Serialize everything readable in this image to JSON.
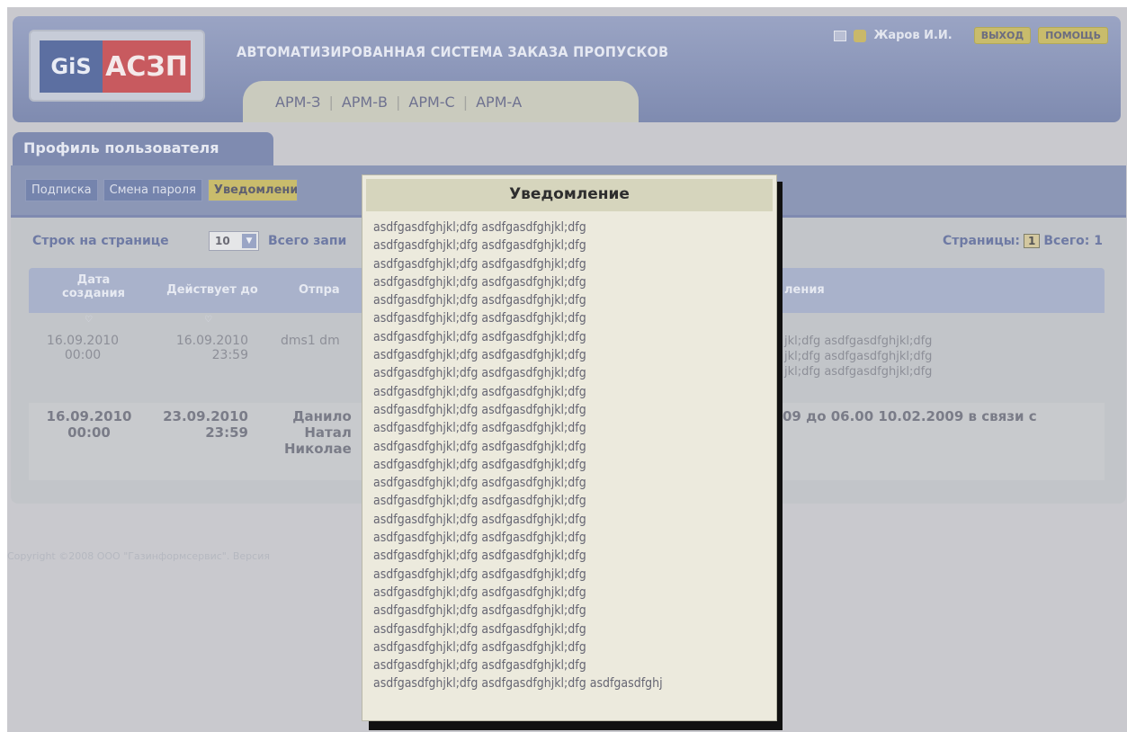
{
  "header": {
    "logo_left": "GiS",
    "logo_right": "АСЗП",
    "system_title": "АВТОМАТИЗИРОВАННАЯ СИСТЕМА ЗАКАЗА ПРОПУСКОВ",
    "user_name": "Жаров И.И.",
    "logout_label": "ВЫХОД",
    "help_label": "ПОМОЩЬ",
    "icons": [
      "mail-icon",
      "user-icon"
    ],
    "arm_tabs": [
      "АРМ-З",
      "АРМ-В",
      "АРМ-С",
      "АРМ-А"
    ]
  },
  "profile": {
    "title": "Профиль пользователя",
    "subtabs": [
      "Подписка",
      "Смена пароля",
      "Уведомления"
    ]
  },
  "grid_tools": {
    "rows_label": "Строк на странице",
    "rows_value": "10",
    "total_label": "Всего запи",
    "pages_label": "Страницы:",
    "page_current": "1",
    "total_pages_label": "Всего: 1"
  },
  "grid": {
    "columns": [
      "Дата создания",
      "Действует до",
      "Отпра",
      "ления"
    ],
    "rows": [
      {
        "created": "16.09.2010\n00:00",
        "valid_until": "16.09.2010\n23:59",
        "sender": "dms1 dm",
        "text": "jkl;dfg asdfgasdfghjkl;dfg\njkl;dfg asdfgasdfghjkl;dfg\njkl;dfg asdfgasdfghjkl;dfg"
      },
      {
        "created": "16.09.2010\n00:00",
        "valid_until": "23.09.2010\n23:59",
        "sender": "Данило\nНатал\nНиколае",
        "text": "09 до 06.00 10.02.2009 в связи с"
      }
    ]
  },
  "footer": {
    "copyright": "Copyright ©2008 ООО \"Газинформсервис\". Версия"
  },
  "modal": {
    "title": "Уведомление",
    "body": "asdfgasdfghjkl;dfg asdfgasdfghjkl;dfg\nasdfgasdfghjkl;dfg asdfgasdfghjkl;dfg\nasdfgasdfghjkl;dfg asdfgasdfghjkl;dfg\nasdfgasdfghjkl;dfg asdfgasdfghjkl;dfg\nasdfgasdfghjkl;dfg asdfgasdfghjkl;dfg\nasdfgasdfghjkl;dfg asdfgasdfghjkl;dfg\nasdfgasdfghjkl;dfg asdfgasdfghjkl;dfg\nasdfgasdfghjkl;dfg asdfgasdfghjkl;dfg\nasdfgasdfghjkl;dfg asdfgasdfghjkl;dfg\nasdfgasdfghjkl;dfg asdfgasdfghjkl;dfg\nasdfgasdfghjkl;dfg asdfgasdfghjkl;dfg\nasdfgasdfghjkl;dfg asdfgasdfghjkl;dfg\nasdfgasdfghjkl;dfg asdfgasdfghjkl;dfg\nasdfgasdfghjkl;dfg asdfgasdfghjkl;dfg\nasdfgasdfghjkl;dfg asdfgasdfghjkl;dfg\nasdfgasdfghjkl;dfg asdfgasdfghjkl;dfg\nasdfgasdfghjkl;dfg asdfgasdfghjkl;dfg\nasdfgasdfghjkl;dfg asdfgasdfghjkl;dfg\nasdfgasdfghjkl;dfg asdfgasdfghjkl;dfg\nasdfgasdfghjkl;dfg asdfgasdfghjkl;dfg\nasdfgasdfghjkl;dfg asdfgasdfghjkl;dfg\nasdfgasdfghjkl;dfg asdfgasdfghjkl;dfg\nasdfgasdfghjkl;dfg asdfgasdfghjkl;dfg\nasdfgasdfghjkl;dfg asdfgasdfghjkl;dfg\nasdfgasdfghjkl;dfg asdfgasdfghjkl;dfg\nasdfgasdfghjkl;dfg asdfgasdfghjkl;dfg asdfgasdfghj"
  }
}
